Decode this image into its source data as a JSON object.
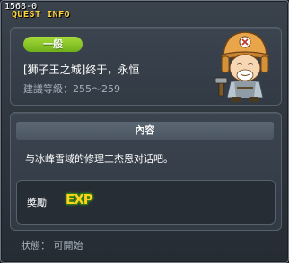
{
  "quest": {
    "id": "1568-0",
    "window_title": "QUEST INFO",
    "category": "一般",
    "name": "[狮子王之城]终于，永恒",
    "level_range": "建議等級：255～259"
  },
  "content": {
    "header": "內容",
    "description": "与冰峰雪域的修理工杰恩对话吧。"
  },
  "reward": {
    "label": "獎勵",
    "exp_label": "EXP"
  },
  "status": {
    "text": "狀態： 可開始"
  },
  "colors": {
    "title": "#ffd23a",
    "category_badge": "#8cc82a",
    "exp": "#ffd21f"
  },
  "icons": {
    "avatar": "repairman-character-portrait"
  }
}
